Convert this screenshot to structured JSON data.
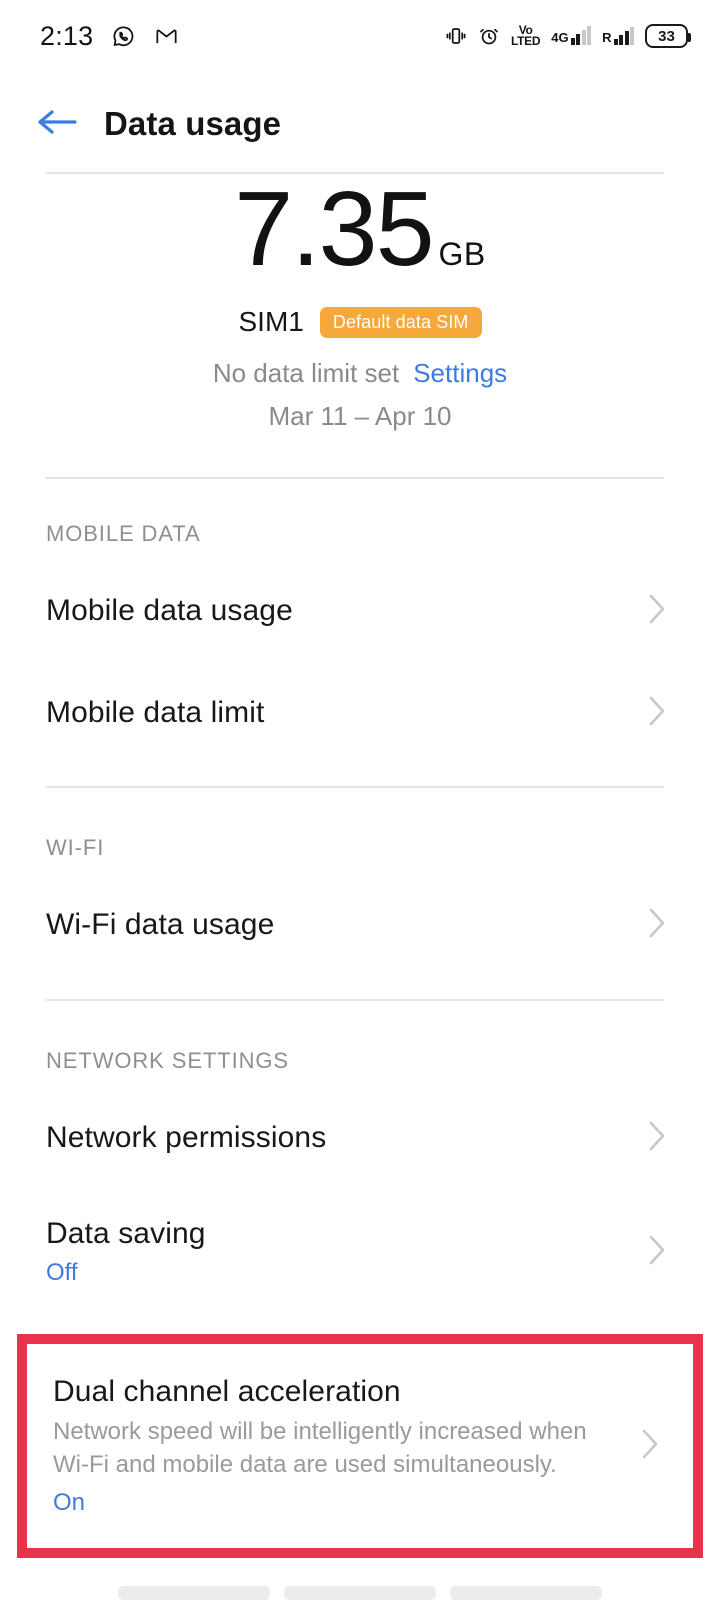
{
  "statusbar": {
    "time": "2:13",
    "left_icons": [
      "whatsapp-icon",
      "gmail-icon"
    ],
    "right_icons": [
      "vibrate-icon",
      "alarm-icon",
      "volte-icon",
      "signal-4g-icon",
      "signal-roaming-icon"
    ],
    "volte_top": "Vo",
    "volte_bottom": "LTED",
    "network_label": "4G",
    "roaming_label": "R",
    "battery_level": "33"
  },
  "appbar": {
    "back_label": "back-arrow",
    "title": "Data usage"
  },
  "summary": {
    "usage_value": "7.35",
    "usage_unit": "GB",
    "sim_name": "SIM1",
    "sim_badge": "Default data SIM",
    "limit_text": "No data limit set",
    "settings_link": "Settings",
    "date_range": "Mar 11 – Apr 10"
  },
  "sections": [
    {
      "header": "MOBILE DATA",
      "rows": [
        {
          "title": "Mobile data usage"
        },
        {
          "title": "Mobile data limit"
        }
      ]
    },
    {
      "header": "WI-FI",
      "rows": [
        {
          "title": "Wi-Fi data usage"
        }
      ]
    },
    {
      "header": "NETWORK SETTINGS",
      "rows": [
        {
          "title": "Network permissions"
        },
        {
          "title": "Data saving",
          "state": "Off"
        }
      ]
    }
  ],
  "highlighted_row": {
    "title": "Dual channel acceleration",
    "subtitle": "Network speed will be intelligently increased when Wi-Fi and mobile data are used simultaneously.",
    "state": "On"
  },
  "colors": {
    "accent_blue": "#3D7BE0",
    "badge_orange": "#F7A83A",
    "highlight_red": "#E8334A",
    "secondary_text": "#8f8f8f"
  }
}
